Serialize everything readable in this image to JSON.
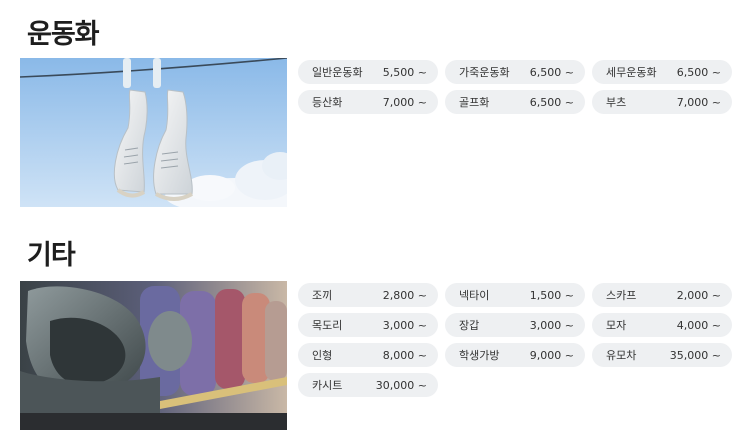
{
  "sections": [
    {
      "title": "운동화",
      "items": [
        {
          "name": "일반운동화",
          "price": "5,500 ~"
        },
        {
          "name": "가죽운동화",
          "price": "6,500 ~"
        },
        {
          "name": "세무운동화",
          "price": "6,500 ~"
        },
        {
          "name": "등산화",
          "price": "7,000 ~"
        },
        {
          "name": "골프화",
          "price": "6,500 ~"
        },
        {
          "name": "부츠",
          "price": "7,000 ~"
        }
      ]
    },
    {
      "title": "기타",
      "items": [
        {
          "name": "조끼",
          "price": "2,800 ~"
        },
        {
          "name": "넥타이",
          "price": "1,500 ~"
        },
        {
          "name": "스카프",
          "price": "2,000 ~"
        },
        {
          "name": "목도리",
          "price": "3,000 ~"
        },
        {
          "name": "장갑",
          "price": "3,000 ~"
        },
        {
          "name": "모자",
          "price": "4,000 ~"
        },
        {
          "name": "인형",
          "price": "8,000 ~"
        },
        {
          "name": "학생가방",
          "price": "9,000 ~"
        },
        {
          "name": "유모차",
          "price": "35,000 ~"
        },
        {
          "name": "카시트",
          "price": "30,000 ~"
        }
      ]
    }
  ]
}
